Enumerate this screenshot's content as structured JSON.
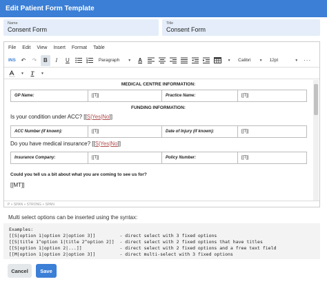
{
  "dialog": {
    "title": "Edit Patient Form Template"
  },
  "fields": {
    "name": {
      "label": "Name",
      "value": "Consent Form"
    },
    "title": {
      "label": "Title",
      "value": "Consent Form"
    }
  },
  "menubar": [
    "File",
    "Edit",
    "View",
    "Insert",
    "Format",
    "Table"
  ],
  "toolbar": {
    "ins_label": "INS",
    "bold": "B",
    "italic": "I",
    "underline": "U",
    "block_format": "Paragraph",
    "font_family": "Calibri",
    "font_size": "12pt"
  },
  "document": {
    "heading1": "MEDICAL CENTRE INFORMATION:",
    "table1": [
      [
        "GP Name:",
        "[[T]]",
        "Practice Name:",
        "[[T]]"
      ]
    ],
    "heading2": "FUNDING INFORMATION:",
    "q1_text": "Is your condition under ACC? [[",
    "q1_opt": "S|Yes|No",
    "q1_end": "]]",
    "table2": [
      [
        "ACC Number (if known):",
        "[[T]]",
        "Date of Injury (if known):",
        "[[T]]"
      ]
    ],
    "q2_text": "Do you have medical insurance? [[",
    "q2_opt": "S|Yes|No",
    "q2_end": "]]",
    "table3": [
      [
        "Insurance Company:",
        "[[T]]",
        "Policy Number:",
        "[[T]]"
      ]
    ],
    "q3": "Could you tell us a bit about what you are coming to see us for?",
    "mt": "[[MT]]"
  },
  "statusbar": "P » SPAN » STRONG » SPAN",
  "help_text": "Multi select options can be inserted using the syntax:",
  "examples": [
    "Examples:",
    "[[S|option 1|option 2|option 3]]         - direct select with 3 fixed options",
    "[[S|title 1^option 1|title 2^option 2]]  - direct select with 2 fixed options that have titles",
    "[[S|option 1|option 2|...]]              - direct select with 2 fixed options and a free text field",
    "[[M|option 1|option 2|option 3]]         - direct multi-select with 3 fixed options"
  ],
  "buttons": {
    "cancel": "Cancel",
    "save": "Save"
  }
}
